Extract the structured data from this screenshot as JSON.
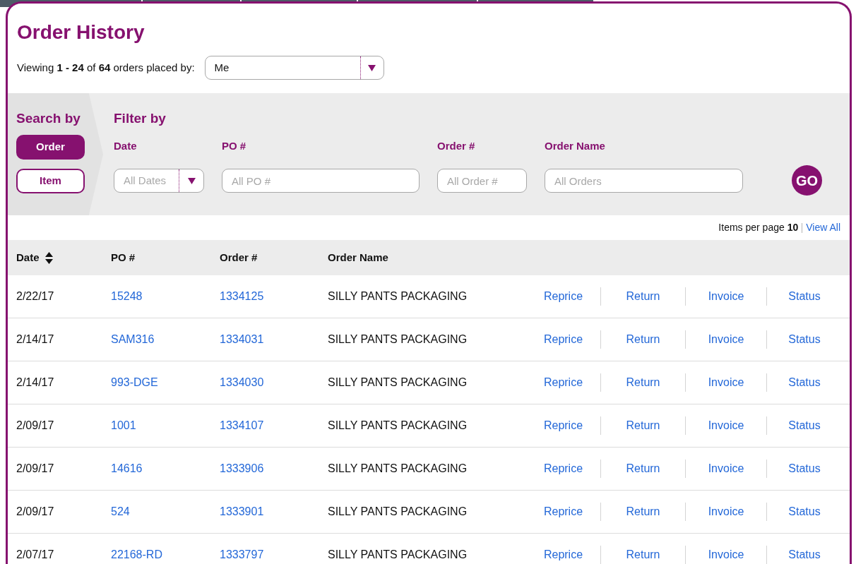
{
  "page": {
    "title": "Order History"
  },
  "summary": {
    "text": "Viewing **1 - 24** of **64** orders placed by:",
    "placed_by": {
      "value": "Me"
    }
  },
  "search_by": {
    "title": "Search by",
    "options": [
      {
        "label": "Order",
        "selected": true
      },
      {
        "label": "Item",
        "selected": false
      }
    ]
  },
  "filter_by": {
    "title": "Filter by",
    "fields": [
      {
        "kind": "select",
        "label": "Date",
        "placeholder": "All Dates"
      },
      {
        "kind": "text",
        "label": "PO #",
        "placeholder": "All PO #"
      },
      {
        "kind": "text",
        "label": "Order #",
        "placeholder": "All Order #"
      },
      {
        "kind": "text",
        "label": "Order Name",
        "placeholder": "All Orders"
      }
    ],
    "go_button": "GO"
  },
  "pagination": {
    "label": "Items per page **10**",
    "view_all": "View All"
  },
  "table": {
    "columns": [
      {
        "label": "Date",
        "sortable": true
      },
      {
        "label": "PO #",
        "sortable": false
      },
      {
        "label": "Order #",
        "sortable": false
      },
      {
        "label": "Order Name",
        "sortable": false
      }
    ],
    "rows": [
      {
        "date": "2/22/17",
        "po": "15248",
        "order": "1334125",
        "name": "SILLY PANTS PACKAGING",
        "actions": [
          "Reprice",
          "Return",
          "Invoice",
          "Status"
        ]
      },
      {
        "date": "2/14/17",
        "po": "SAM316",
        "order": "1334031",
        "name": "SILLY PANTS PACKAGING",
        "actions": [
          "Reprice",
          "Return",
          "Invoice",
          "Status"
        ]
      },
      {
        "date": "2/14/17",
        "po": "993-DGE",
        "order": "1334030",
        "name": "SILLY PANTS PACKAGING",
        "actions": [
          "Reprice",
          "Return",
          "Invoice",
          "Status"
        ]
      },
      {
        "date": "2/09/17",
        "po": "1001",
        "order": "1334107",
        "name": "SILLY PANTS PACKAGING",
        "actions": [
          "Reprice",
          "Return",
          "Invoice",
          "Status"
        ]
      },
      {
        "date": "2/09/17",
        "po": "14616",
        "order": "1333906",
        "name": "SILLY PANTS PACKAGING",
        "actions": [
          "Reprice",
          "Return",
          "Invoice",
          "Status"
        ]
      },
      {
        "date": "2/09/17",
        "po": "524",
        "order": "1333901",
        "name": "SILLY PANTS PACKAGING",
        "actions": [
          "Reprice",
          "Return",
          "Invoice",
          "Status"
        ]
      },
      {
        "date": "2/07/17",
        "po": "22168-RD",
        "order": "1333797",
        "name": "SILLY PANTS PACKAGING",
        "actions": [
          "Reprice",
          "Return",
          "Invoice",
          "Status"
        ]
      }
    ]
  }
}
